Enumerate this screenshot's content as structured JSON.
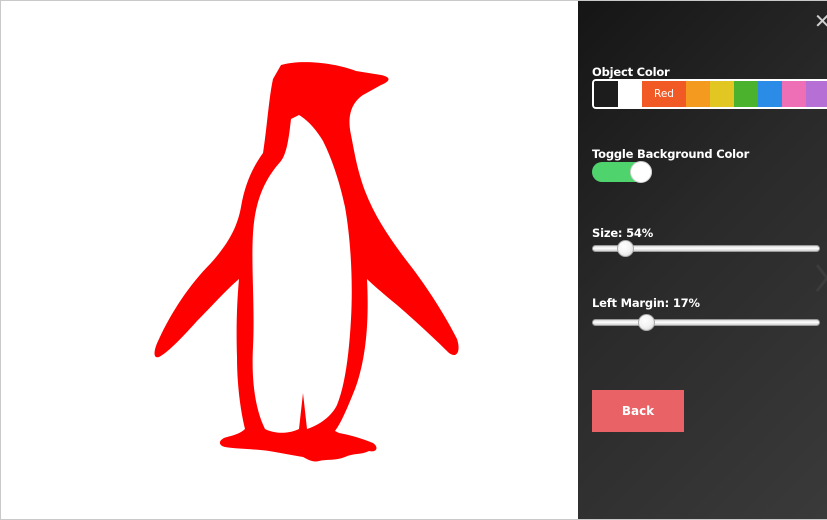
{
  "panel": {
    "close_glyph": "✕",
    "object_color": {
      "label": "Object Color",
      "selected": "Red",
      "swatches": [
        {
          "name": "black",
          "color": "#1c1c1c"
        },
        {
          "name": "white",
          "color": "#ffffff"
        },
        {
          "name": "red",
          "color": "#f15a25",
          "label": "Red"
        },
        {
          "name": "orange",
          "color": "#f39a1f"
        },
        {
          "name": "yellow",
          "color": "#e2c622"
        },
        {
          "name": "green",
          "color": "#4bb22e"
        },
        {
          "name": "blue",
          "color": "#2a8ce6"
        },
        {
          "name": "pink",
          "color": "#ef6fb6"
        },
        {
          "name": "purple",
          "color": "#b66fd4"
        }
      ]
    },
    "toggle_background": {
      "label": "Toggle Background Color",
      "on": true,
      "color_on": "#4fd46d"
    },
    "size": {
      "label": "Size: 54%",
      "value_percent": 54,
      "thumb_fraction": 0.12
    },
    "left_margin": {
      "label": "Left Margin: 17%",
      "value_percent": 17,
      "thumb_fraction": 0.22
    },
    "back_label": "Back",
    "back_color": "#e86266"
  },
  "canvas": {
    "object": "penguin-silhouette",
    "object_color": "#ff0000",
    "background_color": "#ffffff"
  }
}
